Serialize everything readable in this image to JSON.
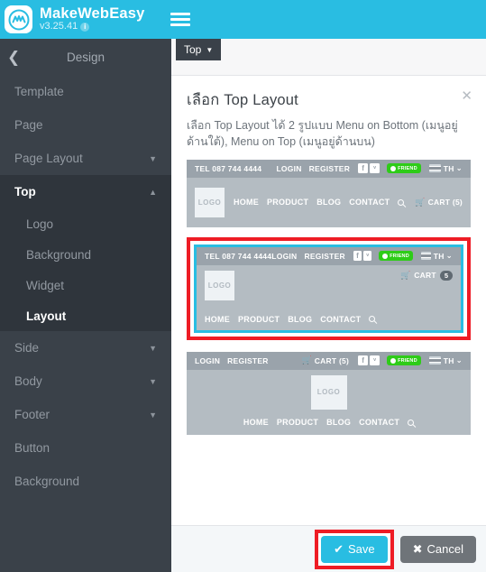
{
  "app": {
    "brand_name": "MakeWebEasy",
    "version": "v3.25.41",
    "info_glyph": "i",
    "menu_icon": "hamburger-menu-icon",
    "accent_color": "#29bde2",
    "sidebar_color": "#3a4149",
    "highlight_color": "#ee1c25"
  },
  "sidebar": {
    "back_glyph": "❮",
    "title": "Design",
    "items": [
      {
        "label": "Template",
        "caret": ""
      },
      {
        "label": "Page",
        "caret": ""
      },
      {
        "label": "Page Layout",
        "caret": "▼"
      },
      {
        "label": "Top",
        "caret": "▲"
      }
    ],
    "top_children": [
      {
        "label": "Logo",
        "active": false
      },
      {
        "label": "Background",
        "active": false
      },
      {
        "label": "Widget",
        "active": false
      },
      {
        "label": "Layout",
        "active": true
      }
    ],
    "items_after": [
      {
        "label": "Side",
        "caret": "▼"
      },
      {
        "label": "Body",
        "caret": "▼"
      },
      {
        "label": "Footer",
        "caret": "▼"
      },
      {
        "label": "Button",
        "caret": ""
      },
      {
        "label": "Background",
        "caret": ""
      }
    ]
  },
  "canvas": {
    "tab_label": "Top",
    "tab_caret": "▼"
  },
  "modal": {
    "title": "เลือก Top Layout",
    "close_glyph": "✕",
    "description": "เลือก Top Layout ได้ 2 รูปแบบ Menu on Bottom (เมนูอยู่ด้านใต้), Menu on Top (เมนูอยู่ด้านบน)",
    "save_label": "Save",
    "save_icon": "check-icon",
    "cancel_label": "Cancel",
    "cancel_icon": "x-icon"
  },
  "shared": {
    "tel": "TEL 087 744 4444",
    "login": "LOGIN",
    "register": "REGISTER",
    "facebook_glyph": "f",
    "twitter_glyph": "ᵛ",
    "line_label": "FRIEND",
    "lang_label": "TH",
    "lang_caret": "⌄",
    "logo_label": "LOGO",
    "nav": [
      "HOME",
      "PRODUCT",
      "BLOG",
      "CONTACT"
    ],
    "search_icon": "search-icon",
    "cart_icon": "cart-icon"
  },
  "options": [
    {
      "id": "menu-inline",
      "selected": false,
      "topbar": {
        "tel": "TEL 087 744 4444",
        "login": "LOGIN",
        "register": "REGISTER"
      },
      "cart_text": "CART (5)",
      "cart_style": "text"
    },
    {
      "id": "menu-on-bottom",
      "selected": true,
      "topbar": {
        "tel": "TEL 087 744 4444",
        "login": "LOGIN",
        "register": "REGISTER"
      },
      "cart_text": "CART",
      "cart_count": "5",
      "cart_style": "pill"
    },
    {
      "id": "menu-on-top",
      "selected": false,
      "topbar": {
        "tel": "",
        "login": "LOGIN",
        "register": "REGISTER"
      },
      "cart_text": "CART (5)",
      "cart_style": "text"
    }
  ]
}
